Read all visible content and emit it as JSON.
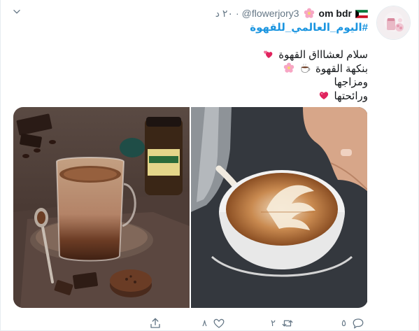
{
  "tweet": {
    "display_name": "om bdr",
    "handle": "@flowerjory3",
    "dot": "·",
    "time": "٢٠ د",
    "hashtag": "#اليوم_العالمي_للقهوة",
    "lines": [
      "سلام لعشاااق القهوة",
      "بنكهة القهوة",
      "ومزاجها",
      "ورائحتها"
    ],
    "icons": {
      "caret": "chevron-down-icon",
      "flag": "kuwait-flag-icon",
      "flower": "cherry-blossom-icon",
      "heart_line1": "two-hearts-icon",
      "coffee": "hot-coffee-icon",
      "heart_line4": "pink-heart-icon"
    },
    "media": [
      {
        "name": "cappuccino-glass-photo"
      },
      {
        "name": "latte-art-photo"
      }
    ]
  },
  "actions": {
    "reply_count": "٥",
    "retweet_count": "٢",
    "like_count": "٨",
    "share_label": ""
  },
  "colors": {
    "accent": "#1b95e0",
    "muted": "#657786",
    "text": "#14171a"
  }
}
